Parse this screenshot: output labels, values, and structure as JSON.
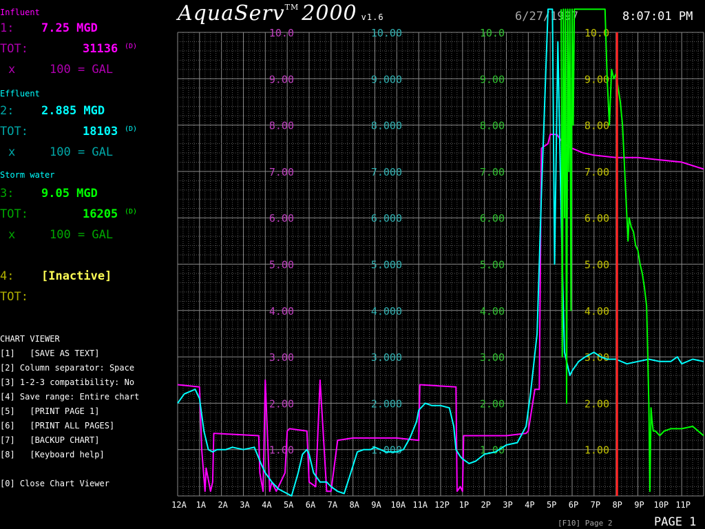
{
  "header": {
    "logo": "AquaServ",
    "trademark": "TM",
    "model": "2000",
    "version": "v1.6",
    "date": "6/27/1997",
    "time": "8:07:01 PM"
  },
  "channels": [
    {
      "title": "Influent",
      "num": "1:",
      "rate": "7.25 MGD",
      "tot_label": "TOT:",
      "total": "31136",
      "unit_flag": "(D)",
      "mult": "x",
      "factor": "100 = GAL",
      "color": "#ff00ff",
      "dim": "#b000b0",
      "title_color": "#ff00ff"
    },
    {
      "title": "Effluent",
      "num": "2:",
      "rate": "2.885 MGD",
      "tot_label": "TOT:",
      "total": "18103",
      "unit_flag": "(D)",
      "mult": "x",
      "factor": "100 = GAL",
      "color": "#00ffff",
      "dim": "#00a8a8",
      "title_color": "#00ffff"
    },
    {
      "title": "Storm water",
      "num": "3:",
      "rate": "9.05 MGD",
      "tot_label": "TOT:",
      "total": "16205",
      "unit_flag": "(D)",
      "mult": "x",
      "factor": "100 = GAL",
      "color": "#00ff00",
      "dim": "#00a800",
      "title_color": "#00ffff"
    },
    {
      "title": "",
      "num": "4:",
      "rate": "[Inactive]",
      "tot_label": "TOT:",
      "total": "",
      "unit_flag": "",
      "mult": "",
      "factor": "",
      "color": "#ffff55",
      "dim": "#b0b000",
      "title_color": "#00ffff"
    }
  ],
  "menu": {
    "title": "CHART VIEWER",
    "items": [
      "[1]   [SAVE AS TEXT]",
      "[2] Column separator: Space",
      "[3] 1-2-3 compatibility: No",
      "[4] Save range: Entire chart",
      "[5]   [PRINT PAGE 1]",
      "[6]   [PRINT ALL PAGES]",
      "[7]   [BACKUP CHART]",
      "[8]   [Keyboard help]"
    ],
    "close": "[0] Close Chart Viewer"
  },
  "footer": {
    "next_page": "[F10] Page 2",
    "page": "PAGE 1"
  },
  "chart_data": {
    "type": "line",
    "x": [
      "12A",
      "1A",
      "2A",
      "3A",
      "4A",
      "5A",
      "6A",
      "7A",
      "8A",
      "9A",
      "10A",
      "11A",
      "12P",
      "1P",
      "2P",
      "3P",
      "4P",
      "5P",
      "6P",
      "7P",
      "8P",
      "9P",
      "10P",
      "11P"
    ],
    "ylim": [
      0,
      10
    ],
    "cursor_hour": 20.05,
    "grid": true,
    "axes": [
      {
        "ticks": [
          "1.00",
          "2.00",
          "3.00",
          "4.00",
          "5.00",
          "6.00",
          "7.00",
          "8.00",
          "9.00",
          "10.0"
        ],
        "color": "#c040c0"
      },
      {
        "ticks": [
          "1.000",
          "2.000",
          "3.000",
          "4.000",
          "5.000",
          "6.000",
          "7.000",
          "8.000",
          "9.000",
          "10.00"
        ],
        "color": "#30b0b0"
      },
      {
        "ticks": [
          "1.00",
          "2.00",
          "3.00",
          "4.00",
          "5.00",
          "6.00",
          "7.00",
          "8.00",
          "9.00",
          "10.0"
        ],
        "color": "#30c030"
      },
      {
        "ticks": [
          "1.00",
          "2.00",
          "3.00",
          "4.00",
          "5.00",
          "6.00",
          "7.00",
          "8.00",
          "9.00",
          "10.0"
        ],
        "color": "#c0c000"
      }
    ],
    "series": [
      {
        "color": "#ff00ff",
        "x": [
          0,
          1,
          1.1,
          1.25,
          1.3,
          1.5,
          1.6,
          1.65,
          3.7,
          3.75,
          3.9,
          4.0,
          4.2,
          4.3,
          4.5,
          4.9,
          5.0,
          5.1,
          5.9,
          6.0,
          6.3,
          6.5,
          6.8,
          7.0,
          7.3,
          8.0,
          10.0,
          11.0,
          11.05,
          12.7,
          12.75,
          12.9,
          13.0,
          13.05,
          15.0,
          15.9,
          16.0,
          16.3,
          16.5,
          16.6,
          16.9,
          17.0,
          17.3,
          17.6,
          18.0,
          18.5,
          19.0,
          20.0,
          21.0,
          22.0,
          23.0,
          24.0
        ],
        "y": [
          2.4,
          2.35,
          1.0,
          0.1,
          0.6,
          0.1,
          0.3,
          1.35,
          1.3,
          0.5,
          0.1,
          2.5,
          0.1,
          0.3,
          0.1,
          0.5,
          1.4,
          1.45,
          1.4,
          0.3,
          0.2,
          2.5,
          0.1,
          0.1,
          1.2,
          1.25,
          1.25,
          1.2,
          2.4,
          2.35,
          0.1,
          0.2,
          0.1,
          1.3,
          1.3,
          1.35,
          1.4,
          2.3,
          2.3,
          7.5,
          7.6,
          7.8,
          7.8,
          7.6,
          7.5,
          7.4,
          7.35,
          7.3,
          7.3,
          7.25,
          7.2,
          7.05
        ]
      },
      {
        "color": "#00ffff",
        "x": [
          0,
          0.3,
          0.8,
          1.0,
          1.2,
          1.4,
          1.6,
          1.8,
          2.2,
          2.5,
          3.0,
          3.5,
          3.8,
          4.0,
          4.3,
          4.6,
          5.0,
          5.2,
          5.5,
          5.7,
          5.9,
          6.0,
          6.2,
          6.5,
          6.8,
          7.0,
          7.3,
          7.6,
          7.9,
          8.2,
          8.5,
          8.8,
          9.0,
          9.5,
          10.0,
          10.3,
          10.6,
          10.9,
          11.0,
          11.3,
          11.6,
          12.0,
          12.4,
          12.6,
          12.7,
          12.9,
          13.0,
          13.3,
          13.6,
          14.0,
          14.5,
          15.0,
          15.5,
          15.9,
          16.1,
          16.4,
          16.6,
          16.9,
          17.1,
          17.2,
          17.35,
          17.5,
          17.65,
          17.8,
          17.9,
          18.0,
          18.3,
          18.6,
          19.0,
          19.3,
          19.6,
          20.0,
          20.5,
          21.0,
          21.5,
          22.0,
          22.5,
          22.8,
          23.0,
          23.5,
          24.0
        ],
        "y": [
          2.0,
          2.2,
          2.3,
          2.1,
          1.4,
          1.0,
          0.95,
          1.0,
          1.0,
          1.05,
          1.0,
          1.05,
          0.7,
          0.5,
          0.3,
          0.15,
          0.05,
          0.0,
          0.5,
          0.9,
          1.0,
          0.9,
          0.5,
          0.3,
          0.3,
          0.2,
          0.1,
          0.05,
          0.5,
          0.95,
          1.0,
          1.0,
          1.05,
          0.95,
          0.95,
          1.0,
          1.25,
          1.6,
          1.85,
          2.0,
          1.95,
          1.95,
          1.9,
          1.5,
          1.0,
          0.85,
          0.8,
          0.7,
          0.75,
          0.9,
          0.95,
          1.1,
          1.15,
          1.5,
          2.2,
          3.5,
          6.5,
          10.5,
          10.5,
          5.0,
          9.8,
          6.0,
          3.1,
          2.8,
          2.6,
          2.7,
          2.9,
          3.0,
          3.1,
          3.0,
          2.95,
          2.95,
          2.85,
          2.9,
          2.95,
          2.9,
          2.9,
          3.0,
          2.85,
          2.95,
          2.9
        ]
      },
      {
        "color": "#00ff00",
        "x": [
          17.5,
          17.55,
          17.6,
          17.65,
          17.7,
          17.75,
          17.8,
          17.85,
          17.9,
          17.95,
          18.0,
          18.05,
          18.1,
          19.5,
          19.6,
          19.7,
          19.8,
          19.9,
          20.0,
          20.1,
          20.2,
          20.3,
          20.4,
          20.45,
          20.5,
          20.55,
          20.6,
          20.7,
          20.8,
          20.9,
          21.0,
          21.1,
          21.2,
          21.3,
          21.4,
          21.5,
          21.55,
          21.6,
          21.65,
          21.7,
          21.8,
          22.0,
          22.2,
          22.5,
          23.0,
          23.5,
          24.0
        ],
        "y": [
          10.5,
          3.0,
          10.5,
          6.0,
          10.5,
          2.0,
          10.5,
          7.0,
          10.5,
          4.0,
          10.5,
          8.0,
          10.5,
          10.5,
          9.0,
          8.0,
          9.2,
          9.0,
          9.1,
          8.8,
          8.5,
          8.0,
          7.0,
          6.5,
          6.0,
          5.5,
          6.0,
          5.8,
          5.7,
          5.4,
          5.3,
          5.0,
          4.8,
          4.5,
          4.1,
          2.0,
          0.1,
          1.9,
          1.6,
          1.4,
          1.4,
          1.3,
          1.4,
          1.45,
          1.45,
          1.5,
          1.3
        ]
      }
    ]
  }
}
